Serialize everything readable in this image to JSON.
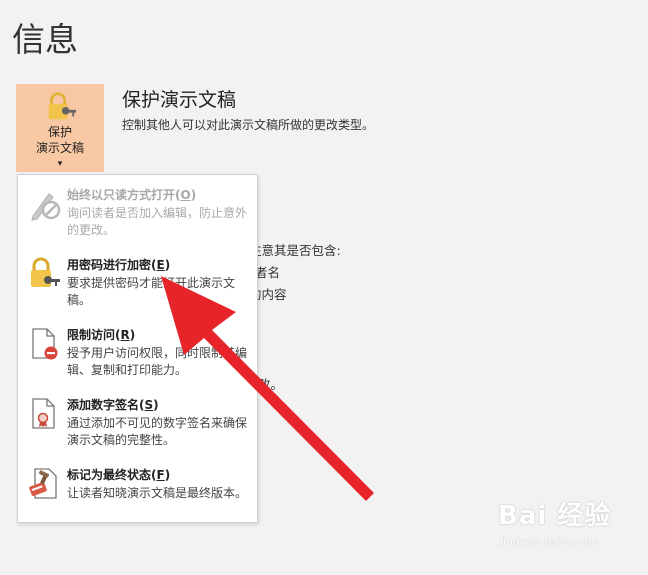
{
  "page": {
    "title": "信息"
  },
  "protect_button": {
    "label_line1": "保护",
    "label_line2": "演示文稿",
    "caret": "▾"
  },
  "section": {
    "title": "保护演示文稿",
    "description": "控制其他人可以对此演示文稿所做的更改类型。"
  },
  "background_fragments": {
    "line1": "注意其是否包含:",
    "line2": "者名",
    "line3": "的内容",
    "line4": "改。",
    "arrow": "▶"
  },
  "menu": {
    "items": [
      {
        "title": "始终以只读方式打开",
        "hotkey": "O",
        "description": "询问读者是否加入编辑，防止意外的更改。",
        "icon": "pencil-prohibited-icon",
        "enabled": false
      },
      {
        "title": "用密码进行加密",
        "hotkey": "E",
        "description": "要求提供密码才能打开此演示文稿。",
        "icon": "lock-key-icon",
        "enabled": true
      },
      {
        "title": "限制访问",
        "hotkey": "R",
        "description": "授予用户访问权限，同时限制其编辑、复制和打印能力。",
        "icon": "document-restrict-icon",
        "enabled": true
      },
      {
        "title": "添加数字签名",
        "hotkey": "S",
        "description": "通过添加不可见的数字签名来确保演示文稿的完整性。",
        "icon": "document-ribbon-icon",
        "enabled": true
      },
      {
        "title": "标记为最终状态",
        "hotkey": "F",
        "description": "让读者知晓演示文稿是最终版本。",
        "icon": "final-stamp-icon",
        "enabled": true
      }
    ]
  },
  "watermark": {
    "brand": "Bai 经验",
    "url": "jingyan.baidu.com"
  },
  "colors": {
    "accent_button": "#f8c8a4",
    "arrow": "#e8242b",
    "background": "#f2f2f2"
  }
}
